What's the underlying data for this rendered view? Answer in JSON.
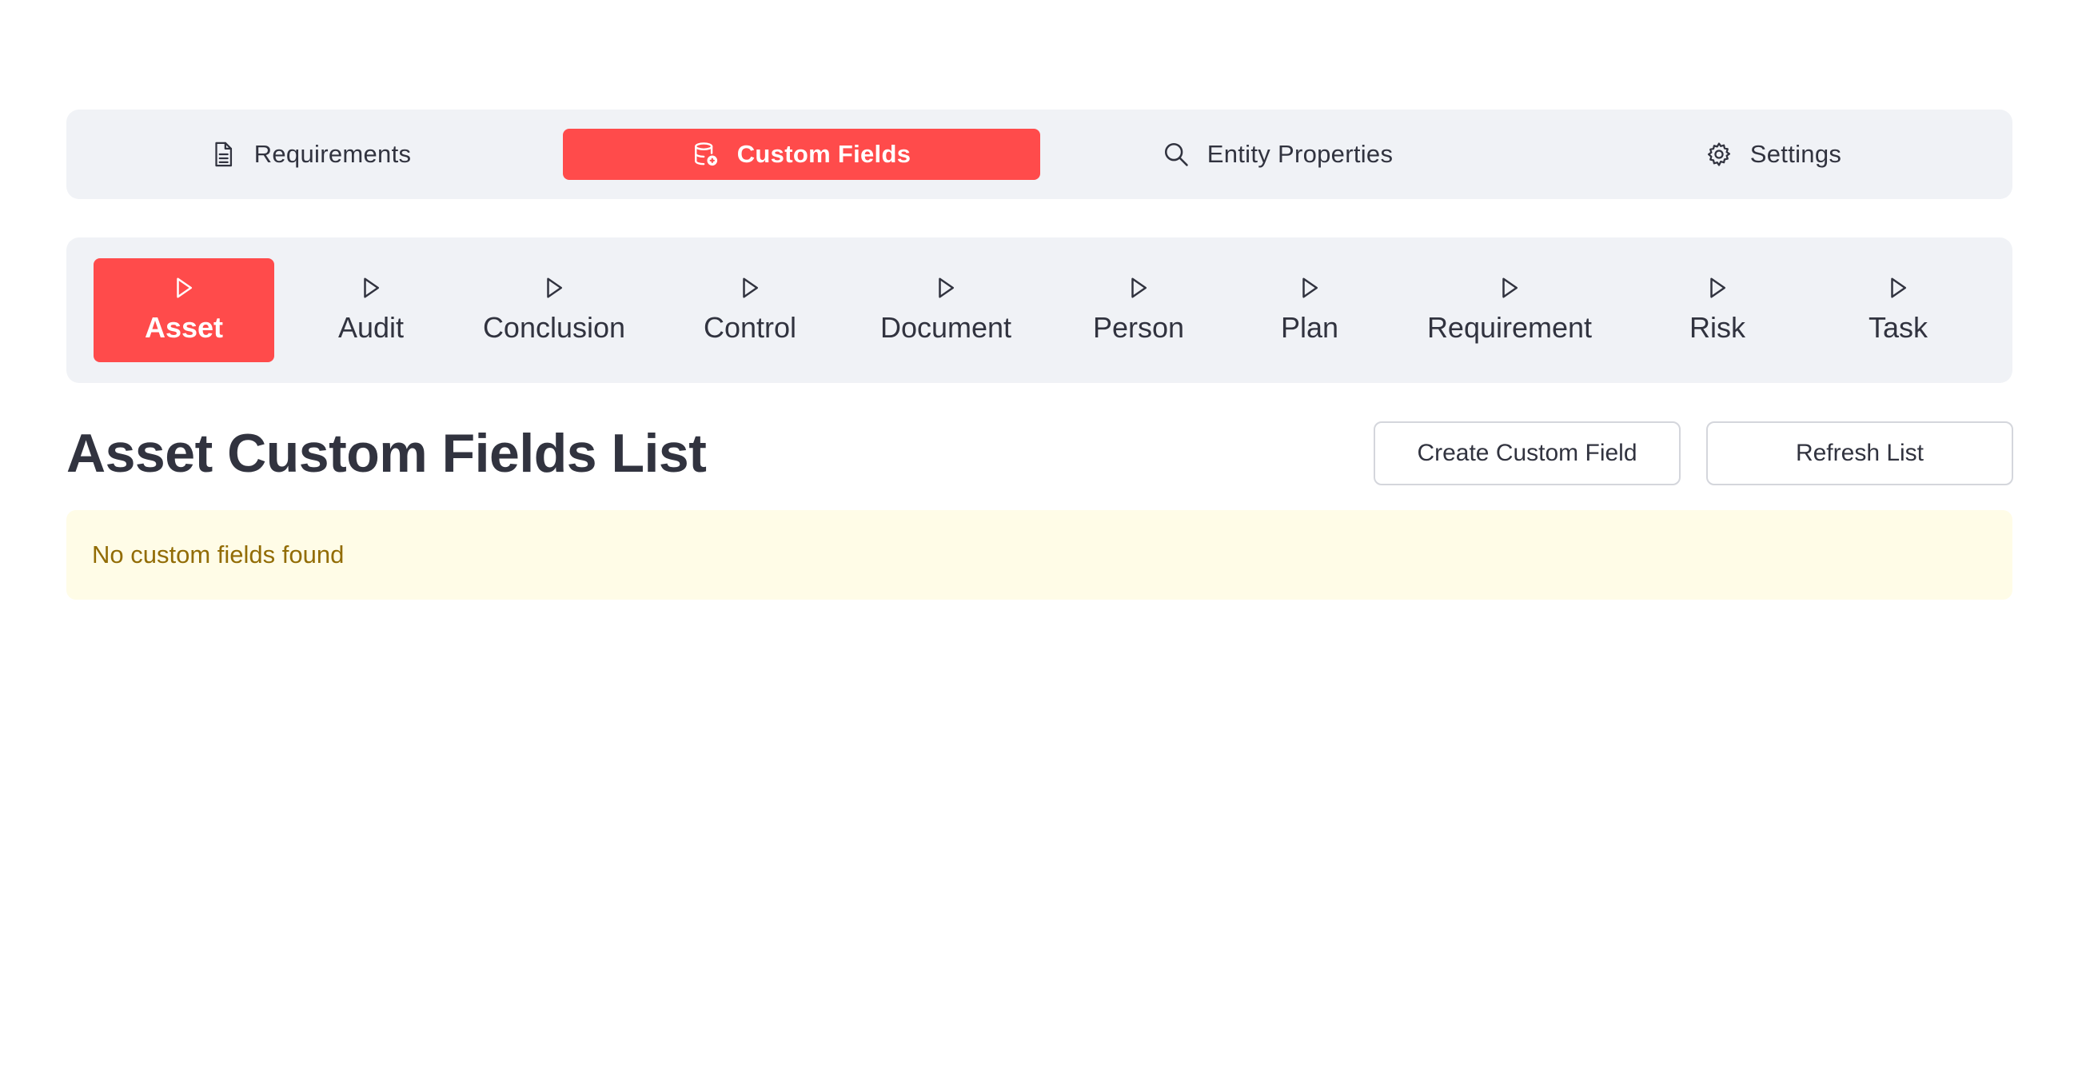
{
  "top_nav": {
    "tabs": [
      {
        "label": "Requirements",
        "icon": "document-icon",
        "active": false
      },
      {
        "label": "Custom Fields",
        "icon": "database-icon",
        "active": true
      },
      {
        "label": "Entity Properties",
        "icon": "search-icon",
        "active": false
      },
      {
        "label": "Settings",
        "icon": "gear-icon",
        "active": false
      }
    ]
  },
  "entity_nav": {
    "tabs": [
      {
        "label": "Asset",
        "active": true
      },
      {
        "label": "Audit",
        "active": false
      },
      {
        "label": "Conclusion",
        "active": false
      },
      {
        "label": "Control",
        "active": false
      },
      {
        "label": "Document",
        "active": false
      },
      {
        "label": "Person",
        "active": false
      },
      {
        "label": "Plan",
        "active": false
      },
      {
        "label": "Requirement",
        "active": false
      },
      {
        "label": "Risk",
        "active": false
      },
      {
        "label": "Task",
        "active": false
      }
    ]
  },
  "main": {
    "title": "Asset Custom Fields List",
    "create_button": "Create Custom Field",
    "refresh_button": "Refresh List",
    "empty_message": "No custom fields found"
  },
  "colors": {
    "accent": "#ff4b4b",
    "nav_bg": "#f0f2f6",
    "alert_bg": "#fffce7",
    "alert_text": "#926c05"
  }
}
